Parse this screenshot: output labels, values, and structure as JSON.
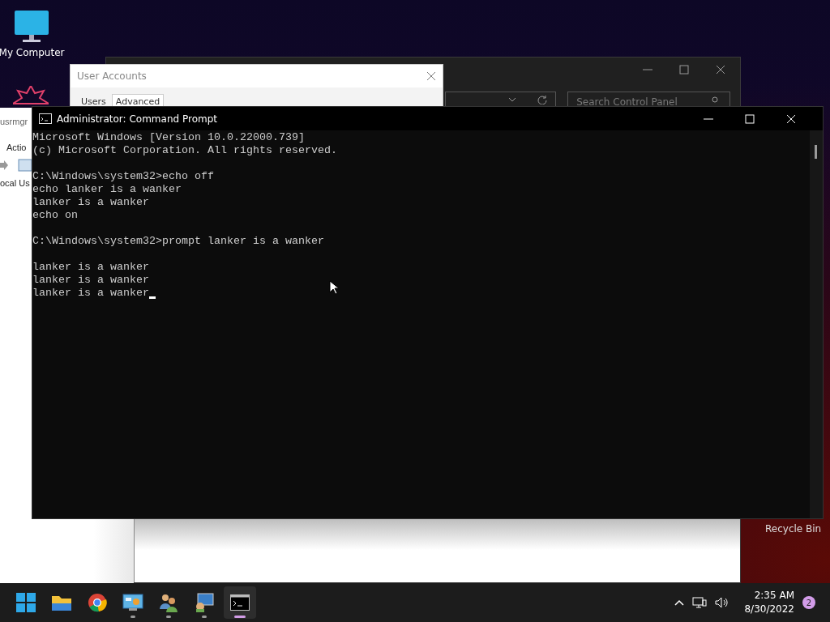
{
  "desktop_icons": [
    {
      "kind": "computer",
      "label": "My Computer"
    },
    {
      "kind": "recycle",
      "label": "Recycle Bin"
    }
  ],
  "control_panel": {
    "search": {
      "placeholder": "Search Control Panel"
    }
  },
  "user_accounts": {
    "title": "User Accounts",
    "tabs": [
      {
        "label": "Users",
        "selected": false
      },
      {
        "label": "Advanced",
        "selected": true
      }
    ]
  },
  "local_users": {
    "title": "usrmgr",
    "menu": [
      "Actio"
    ],
    "tree_item": "ocal Us"
  },
  "command_prompt": {
    "title": "Administrator: Command Prompt",
    "cursor_visible": true,
    "blocks": [
      [
        "Microsoft Windows [Version 10.0.22000.739]",
        "(c) Microsoft Corporation. All rights reserved."
      ],
      [
        "C:\\Windows\\system32>echo off",
        "echo lanker is a wanker",
        "lanker is a wanker",
        "echo on"
      ],
      [
        "C:\\Windows\\system32>prompt lanker is a wanker"
      ],
      [
        "lanker is a wanker",
        "lanker is a wanker",
        "lanker is a wanker"
      ]
    ]
  },
  "taskbar": {
    "apps": [
      {
        "kind": "start",
        "running": false,
        "selected": false
      },
      {
        "kind": "folder",
        "running": false,
        "selected": false
      },
      {
        "kind": "browser",
        "running": false,
        "selected": false
      },
      {
        "kind": "control-panel",
        "running": true,
        "selected": false
      },
      {
        "kind": "users",
        "running": true,
        "selected": false
      },
      {
        "kind": "computer-management",
        "running": true,
        "selected": false
      },
      {
        "kind": "terminal",
        "running": true,
        "selected": true
      }
    ],
    "time": "2:35 AM",
    "date": "8/30/2022",
    "notification_count": "2"
  }
}
